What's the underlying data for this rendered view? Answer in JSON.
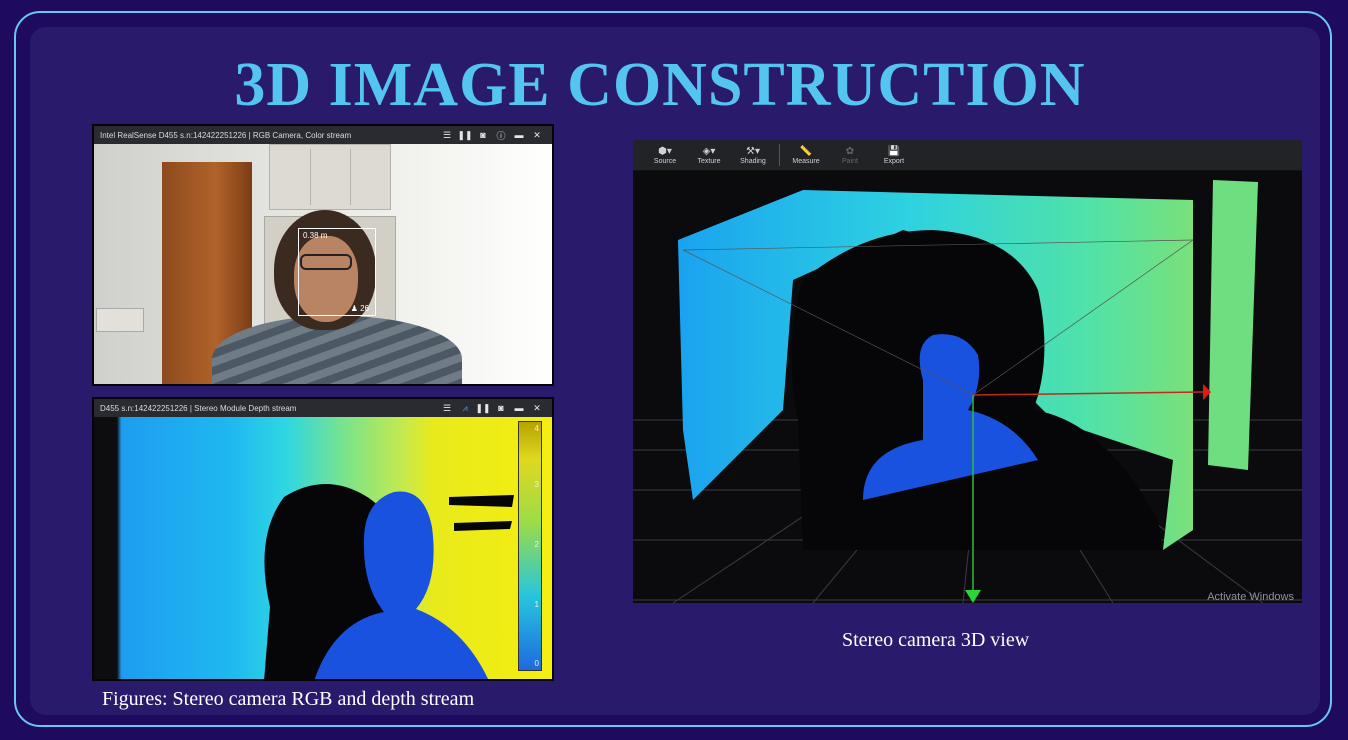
{
  "slide": {
    "title": "3D IMAGE CONSTRUCTION",
    "left_caption": "Figures: Stereo camera RGB and depth stream",
    "right_caption": "Stereo camera 3D view",
    "colors": {
      "background": "#1e0a5e",
      "panel": "#2a1a6b",
      "title": "#54c4f0",
      "frame_border": "#69c8f2"
    }
  },
  "rgb_view": {
    "title": "Intel RealSense D455 s.n:142422251226 | RGB Camera, Color stream",
    "icons": [
      "list-icon",
      "pause-icon",
      "camera-icon",
      "info-icon",
      "minimize-icon",
      "close-icon"
    ],
    "distance_label": "0.38 m",
    "person_count": "26"
  },
  "depth_view": {
    "title": "D455 s.n:142422251226 | Stereo Module Depth stream",
    "icons": [
      "list-icon",
      "chart-icon",
      "pause-icon",
      "camera-icon",
      "minimize-icon",
      "close-icon"
    ],
    "scale_ticks": [
      "4",
      "3",
      "2",
      "1",
      "0"
    ]
  },
  "viewer_3d": {
    "toolbar": [
      {
        "label": "Source",
        "icon": "cube-icon",
        "enabled": true
      },
      {
        "label": "Texture",
        "icon": "paint-bucket-icon",
        "enabled": true
      },
      {
        "label": "Shading",
        "icon": "brush-icon",
        "enabled": true
      },
      {
        "label": "Measure",
        "icon": "ruler-icon",
        "enabled": true
      },
      {
        "label": "Paint",
        "icon": "paw-icon",
        "enabled": false
      },
      {
        "label": "Export",
        "icon": "save-icon",
        "enabled": true
      }
    ],
    "watermark": "Activate Windows"
  }
}
